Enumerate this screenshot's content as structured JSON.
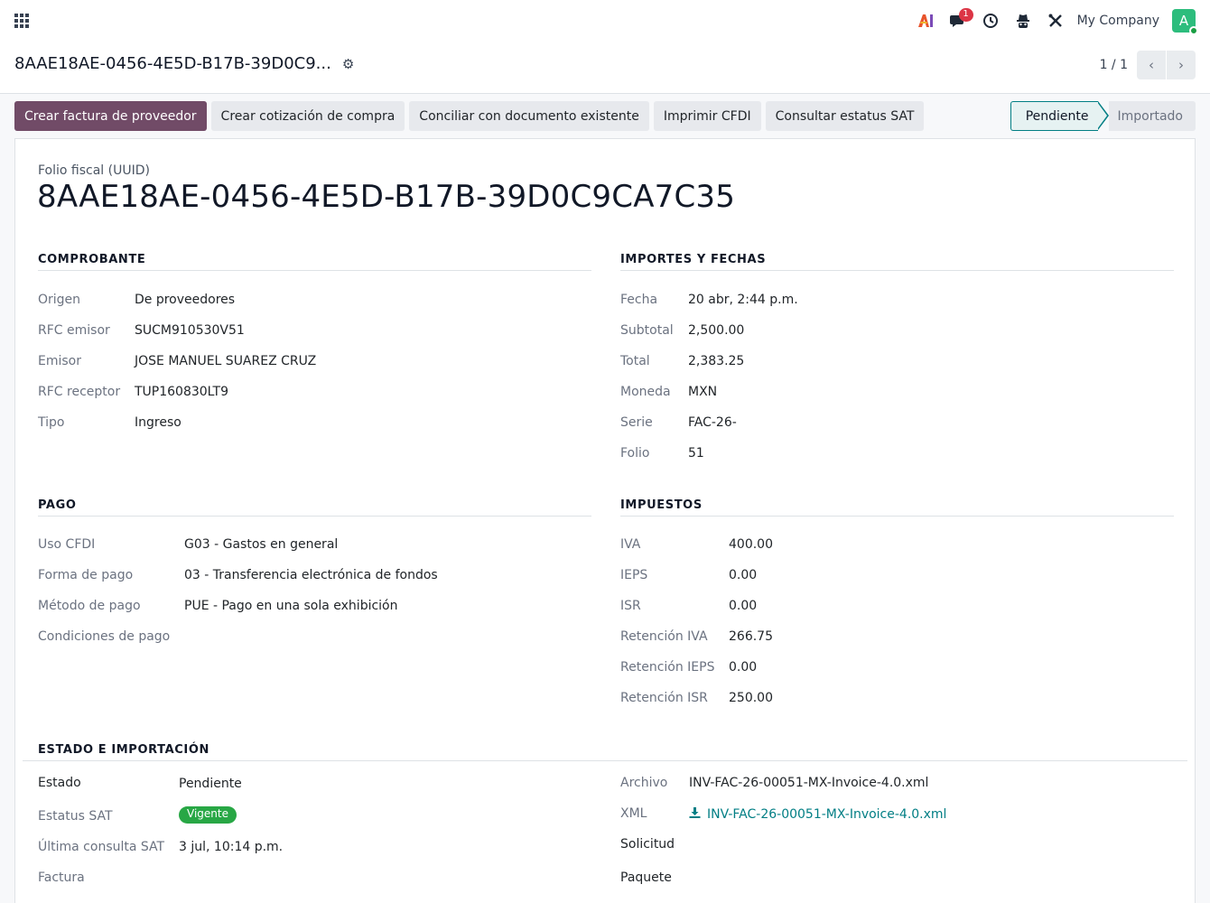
{
  "navbar": {
    "company": "My Company",
    "avatar_letter": "A",
    "messages_count": "1",
    "icons": [
      "apps-icon",
      "ai-icon",
      "chat-icon",
      "clock-icon",
      "spy-icon",
      "tools-icon"
    ]
  },
  "control_panel": {
    "title": "8AAE18AE-0456-4E5D-B17B-39D0C9...",
    "pager_value": "1 / 1"
  },
  "actions": {
    "create_vendor_bill": "Crear factura de proveedor",
    "create_purchase_quote": "Crear cotización de compra",
    "reconcile": "Conciliar con documento existente",
    "print_cfdi": "Imprimir CFDI",
    "check_sat": "Consultar estatus SAT"
  },
  "statusbar": {
    "active": "Pendiente",
    "next": "Importado"
  },
  "form": {
    "uuid_label": "Folio fiscal (UUID)",
    "uuid": "8AAE18AE-0456-4E5D-B17B-39D0C9CA7C35",
    "comprobante": {
      "title": "COMPROBANTE",
      "rows": [
        {
          "label": "Origen",
          "value": "De proveedores"
        },
        {
          "label": "RFC emisor",
          "value": "SUCM910530V51"
        },
        {
          "label": "Emisor",
          "value": "JOSE MANUEL SUAREZ CRUZ"
        },
        {
          "label": "RFC receptor",
          "value": "TUP160830LT9"
        },
        {
          "label": "Tipo",
          "value": "Ingreso"
        }
      ]
    },
    "importes": {
      "title": "IMPORTES Y FECHAS",
      "rows": [
        {
          "label": "Fecha",
          "value": "20 abr, 2:44 p.m."
        },
        {
          "label": "Subtotal",
          "value": "2,500.00"
        },
        {
          "label": "Total",
          "value": "2,383.25"
        },
        {
          "label": "Moneda",
          "value": "MXN"
        },
        {
          "label": "Serie",
          "value": "FAC-26-"
        },
        {
          "label": "Folio",
          "value": "51"
        }
      ]
    },
    "pago": {
      "title": "PAGO",
      "rows": [
        {
          "label": "Uso CFDI",
          "value": "G03 - Gastos en general"
        },
        {
          "label": "Forma de pago",
          "value": "03 - Transferencia electrónica de fondos"
        },
        {
          "label": "Método de pago",
          "value": "PUE - Pago en una sola exhibición"
        },
        {
          "label": "Condiciones de pago",
          "value": ""
        }
      ]
    },
    "impuestos": {
      "title": "IMPUESTOS",
      "rows": [
        {
          "label": "IVA",
          "value": "400.00"
        },
        {
          "label": "IEPS",
          "value": "0.00"
        },
        {
          "label": "ISR",
          "value": "0.00"
        },
        {
          "label": "Retención IVA",
          "value": "266.75"
        },
        {
          "label": "Retención IEPS",
          "value": "0.00"
        },
        {
          "label": "Retención ISR",
          "value": "250.00"
        }
      ]
    },
    "estado": {
      "title": "ESTADO E IMPORTACIÓN",
      "estado_label": "Estado",
      "estado_value": "Pendiente",
      "sat_label": "Estatus SAT",
      "sat_value": "Vigente",
      "sat_color": "#28a745",
      "last_check_label": "Última consulta SAT",
      "last_check_value": "3 jul, 10:14 p.m.",
      "invoice_label": "Factura",
      "archivo_label": "Archivo",
      "archivo_value": "INV-FAC-26-00051-MX-Invoice-4.0.xml",
      "xml_label": "XML",
      "xml_value": "INV-FAC-26-00051-MX-Invoice-4.0.xml",
      "solicitud_label": "Solicitud",
      "paquete_label": "Paquete"
    }
  },
  "colors": {
    "primary": "#714b67",
    "accent": "#017e84",
    "success": "#28a745",
    "danger": "#dc3545"
  }
}
